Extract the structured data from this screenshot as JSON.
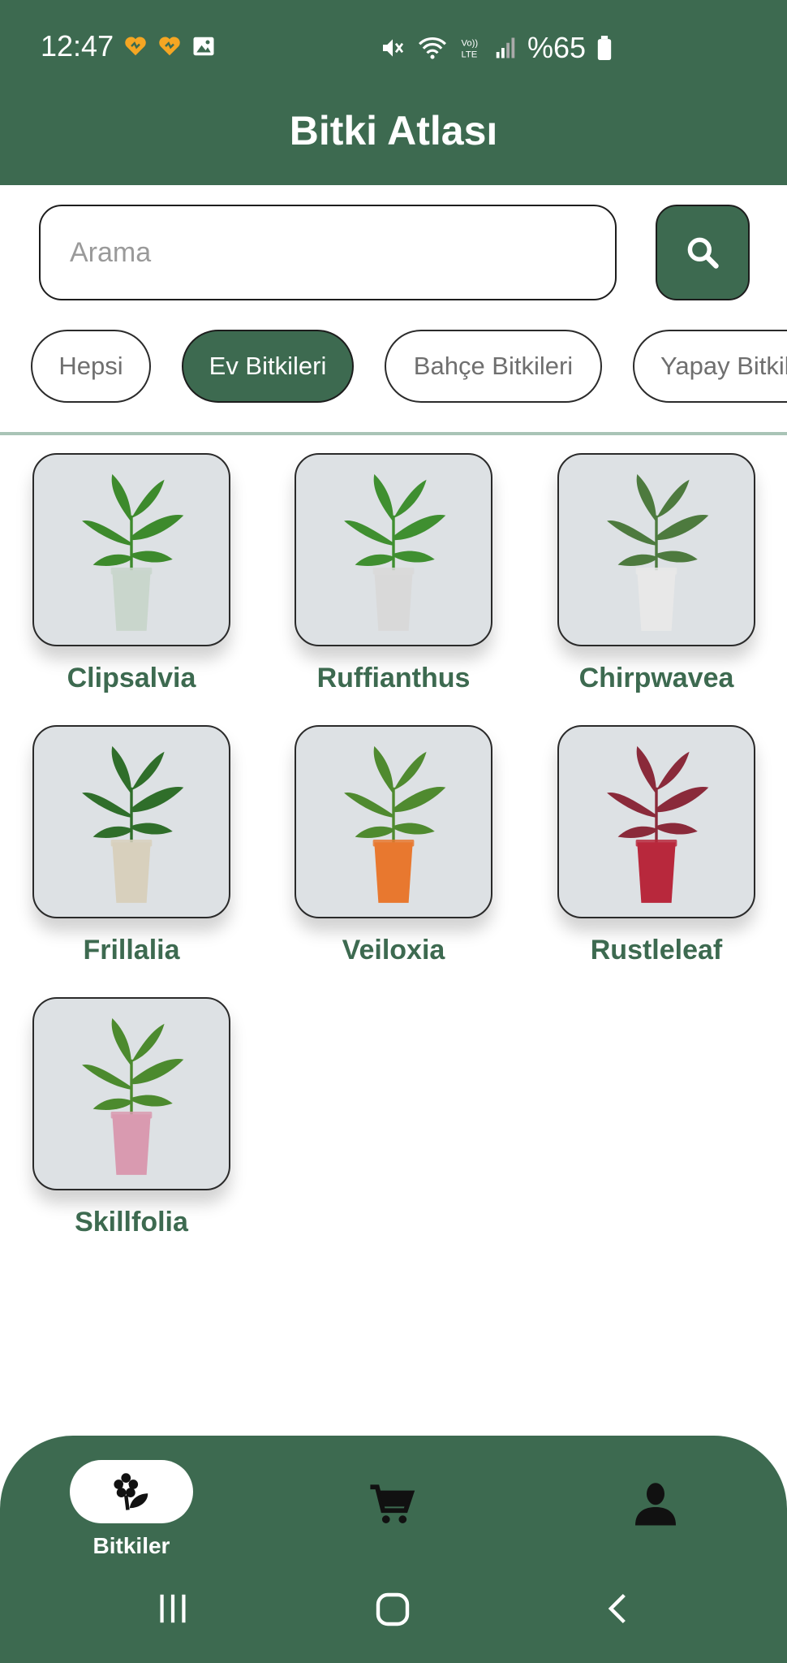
{
  "status_bar": {
    "time": "12:47",
    "battery": "%65",
    "network_label": "VoLTE"
  },
  "app": {
    "title": "Bitki Atlası"
  },
  "search": {
    "placeholder": "Arama",
    "value": ""
  },
  "filters": [
    {
      "label": "Hepsi",
      "selected": false
    },
    {
      "label": "Ev Bitkileri",
      "selected": true
    },
    {
      "label": "Bahçe Bitkileri",
      "selected": false
    },
    {
      "label": "Yapay Bitkiler",
      "selected": false
    }
  ],
  "plants": [
    {
      "name": "Clipsalvia",
      "pot_color": "#c9d6cc",
      "leaf_color": "#3d8a2c"
    },
    {
      "name": "Ruffianthus",
      "pot_color": "#d9d9d9",
      "leaf_color": "#3f8f30"
    },
    {
      "name": "Chirpwavea",
      "pot_color": "#e8e8e8",
      "leaf_color": "#4d7a3e"
    },
    {
      "name": "Frillalia",
      "pot_color": "#d8d0bd",
      "leaf_color": "#2f6e2a"
    },
    {
      "name": "Veiloxia",
      "pot_color": "#e8782f",
      "leaf_color": "#4f8a2f"
    },
    {
      "name": "Rustleleaf",
      "pot_color": "#b8283c",
      "leaf_color": "#8a2a3a"
    },
    {
      "name": "Skillfolia",
      "pot_color": "#d99ab0",
      "leaf_color": "#4c8a2e"
    }
  ],
  "bottom_nav": {
    "items": [
      {
        "label": "Bitkiler",
        "icon": "plant-icon",
        "active": true
      },
      {
        "label": "",
        "icon": "cart-icon",
        "active": false
      },
      {
        "label": "",
        "icon": "person-icon",
        "active": false
      }
    ]
  },
  "colors": {
    "primary": "#3d6a50",
    "accent_text": "#3d6a50",
    "card_bg": "#dde1e4"
  }
}
